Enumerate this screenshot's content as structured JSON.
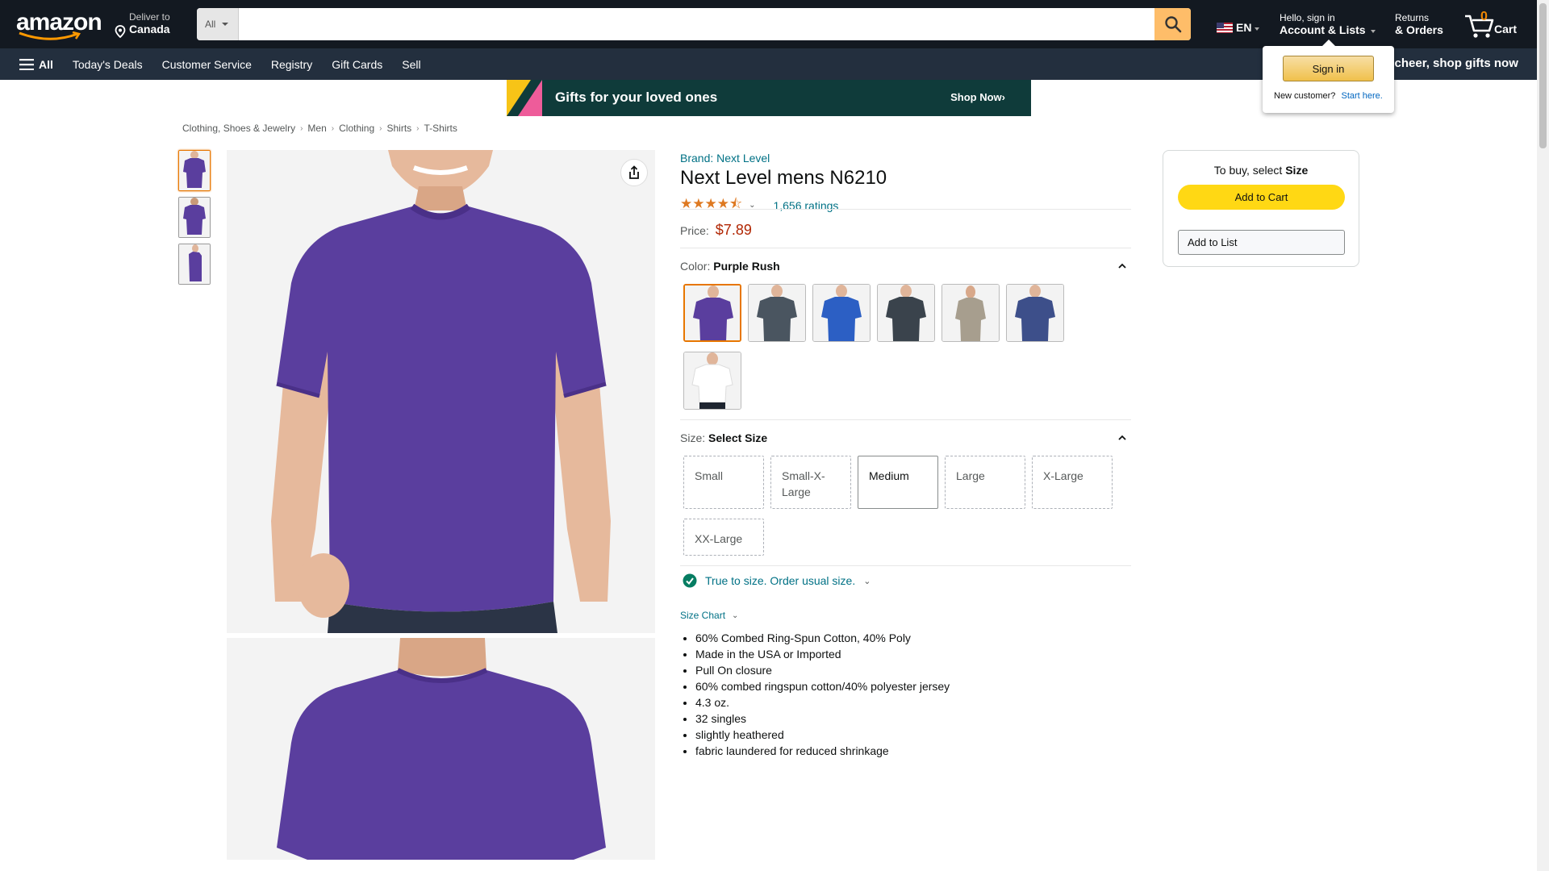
{
  "nav": {
    "logo": "amazon",
    "deliver_line1": "Deliver to",
    "deliver_line2": "Canada",
    "search_category": "All",
    "search_placeholder": "",
    "lang": "EN",
    "account_line1": "Hello, sign in",
    "account_line2": "Account & Lists",
    "returns_line1": "Returns",
    "returns_line2": "& Orders",
    "cart_count": "0",
    "cart_label": "Cart"
  },
  "subnav": {
    "all_label": "All",
    "items": [
      "Today's Deals",
      "Customer Service",
      "Registry",
      "Gift Cards",
      "Sell"
    ],
    "promo": "e cheer, shop gifts now"
  },
  "flyout": {
    "signin_label": "Sign in",
    "new_customer": "New customer?",
    "start_here": "Start here."
  },
  "banner": {
    "text": "Gifts for your loved ones",
    "cta": "Shop Now›"
  },
  "breadcrumb": [
    "Clothing, Shoes & Jewelry",
    "Men",
    "Clothing",
    "Shirts",
    "T-Shirts"
  ],
  "product": {
    "brand": "Brand: Next Level",
    "title": "Next Level mens N6210",
    "rating_stars": "4.5",
    "rating_count": "1,656 ratings",
    "price_label": "Price:",
    "price": "$7.89",
    "color_label": "Color:",
    "color_value": "Purple Rush",
    "size_label": "Size:",
    "size_value": "Select Size",
    "sizes": [
      "Small",
      "Small-X-Large",
      "Medium",
      "Large",
      "X-Large",
      "XX-Large"
    ],
    "fit_text": "True to size. Order usual size.",
    "size_chart": "Size Chart",
    "bullets": [
      "60% Combed Ring-Spun Cotton, 40% Poly",
      "Made in the USA or Imported",
      "Pull On closure",
      "60% combed ringspun cotton/40% polyester jersey",
      "4.3 oz.",
      "32 singles",
      "slightly heathered",
      "fabric laundered for reduced shrinkage"
    ]
  },
  "buybox": {
    "title_prefix": "To buy, select",
    "title_bold": "Size",
    "add_to_cart": "Add to Cart",
    "add_to_list": "Add to List"
  },
  "colors": {
    "nav_bg": "#131921",
    "subnav_bg": "#232f3e",
    "accent": "#febd69",
    "price": "#b12704",
    "link": "#007185",
    "shirt_purple": "#5a3e9e",
    "add_to_cart": "#ffd814"
  }
}
